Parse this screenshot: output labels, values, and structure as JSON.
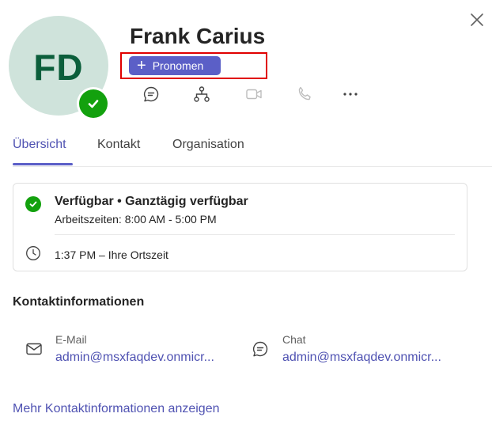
{
  "profile": {
    "name": "Frank Carius",
    "initials": "FD",
    "pronouns_button": "Pronomen",
    "presence": "available"
  },
  "actions": [
    {
      "icon": "chat-icon"
    },
    {
      "icon": "org-chart-icon"
    },
    {
      "icon": "video-call-icon"
    },
    {
      "icon": "phone-call-icon"
    },
    {
      "icon": "more-options-icon"
    }
  ],
  "tabs": [
    {
      "label": "Übersicht",
      "active": true
    },
    {
      "label": "Kontakt",
      "active": false
    },
    {
      "label": "Organisation",
      "active": false
    }
  ],
  "status_card": {
    "status": "Verfügbar • Ganztägig verfügbar",
    "work_hours": "Arbeitszeiten: 8:00 AM - 5:00 PM",
    "local_time": "1:37 PM – Ihre Ortszeit"
  },
  "contact": {
    "title": "Kontaktinformationen",
    "email_label": "E-Mail",
    "email_value": "admin@msxfaqdev.onmicr...",
    "chat_label": "Chat",
    "chat_value": "admin@msxfaqdev.onmicr...",
    "more_link": "Mehr Kontaktinformationen anzeigen"
  },
  "colors": {
    "accent": "#5b5fc7",
    "available": "#13a10e",
    "avatar_bg": "#cfe3db",
    "avatar_text": "#0b5e3b",
    "highlight": "#e00000"
  }
}
